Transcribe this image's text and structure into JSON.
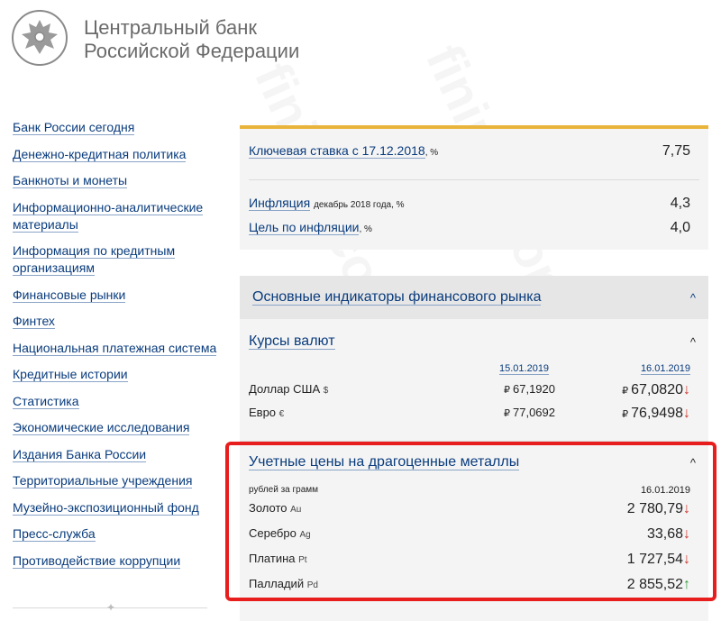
{
  "header": {
    "brand_line1": "Центральный банк",
    "brand_line2": "Российской Федерации"
  },
  "nav": {
    "items": [
      "Банк России сегодня",
      "Денежно-кредитная политика",
      "Банкноты и монеты",
      "Информационно-аналитические материалы",
      "Информация по кредитным организациям",
      "Финансовые рынки",
      "Финтех",
      "Национальная платежная система",
      "Кредитные истории",
      "Статистика",
      "Экономические исследования",
      "Издания Банка России",
      "Территориальные учреждения",
      "Музейно-экспозиционный фонд",
      "Пресс-служба",
      "Противодействие коррупции"
    ]
  },
  "rates": {
    "key_rate_label": "Ключевая ставка с 17.12.2018",
    "key_rate_unit": ", %",
    "key_rate_value": "7,75",
    "inflation_label": "Инфляция",
    "inflation_note": "декабрь 2018 года, %",
    "inflation_value": "4,3",
    "target_label": "Цель по инфляции",
    "target_unit": ", %",
    "target_value": "4,0"
  },
  "market": {
    "title": "Основные индикаторы финансового рынка",
    "currencies": {
      "title": "Курсы валют",
      "date1": "15.01.2019",
      "date2": "16.01.2019",
      "rows": [
        {
          "name": "Доллар США",
          "symbol": "$",
          "v1": "67,1920",
          "v2": "67,0820",
          "trend": "↓"
        },
        {
          "name": "Евро",
          "symbol": "€",
          "v1": "77,0692",
          "v2": "76,9498",
          "trend": "↓"
        }
      ]
    },
    "metals": {
      "title": "Учетные цены на драгоценные металлы",
      "unit": "рублей за грамм",
      "date": "16.01.2019",
      "rows": [
        {
          "name": "Золото",
          "symbol": "Au",
          "value": "2 780,79",
          "trend": "↓"
        },
        {
          "name": "Серебро",
          "symbol": "Ag",
          "value": "33,68",
          "trend": "↓"
        },
        {
          "name": "Платина",
          "symbol": "Pt",
          "value": "1 727,54",
          "trend": "↓"
        },
        {
          "name": "Палладий",
          "symbol": "Pd",
          "value": "2 855,52",
          "trend": "↑"
        }
      ]
    }
  },
  "symbols": {
    "ruble": "₽",
    "chevron_up": "^",
    "divider_mark": "✦"
  },
  "watermark": "fininru.com",
  "colors": {
    "link": "#0a3c7d",
    "accent": "#e9b43b",
    "highlight": "#e81d1d",
    "down": "#d0342c",
    "up": "#2f9b3a"
  }
}
